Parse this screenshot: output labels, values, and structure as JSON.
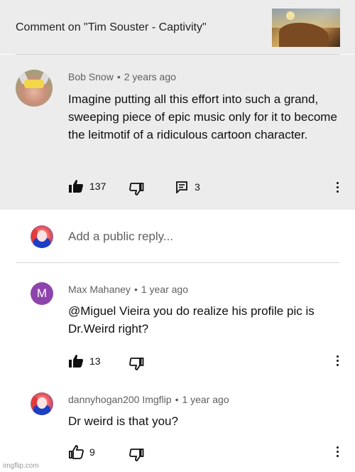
{
  "header": {
    "title": "Comment on \"Tim Souster - Captivity\"",
    "thumbnail_icon": "video-thumbnail"
  },
  "main_comment": {
    "author": "Bob Snow",
    "time": "2 years ago",
    "text": "Imagine putting all this effort into such a grand, sweeping piece of epic music only for it to become the leitmotif of a ridiculous cartoon character.",
    "likes": "137",
    "replies": "3"
  },
  "reply_input": {
    "placeholder": "Add a public reply..."
  },
  "replies": [
    {
      "author": "Max Mahaney",
      "time": "1 year ago",
      "avatar_letter": "M",
      "text": "@Miguel Vieira you do realize his profile pic is Dr.Weird right?",
      "likes": "13"
    },
    {
      "author": "dannyhogan200 Imgflip",
      "time": "1 year ago",
      "text": "Dr weird is that you?",
      "likes": "9"
    }
  ],
  "separator": "•",
  "watermark": "imgflip.com",
  "colors": {
    "header_bg": "#ececec",
    "meta_text": "#606060",
    "avatar_m": "#8e44ad"
  }
}
